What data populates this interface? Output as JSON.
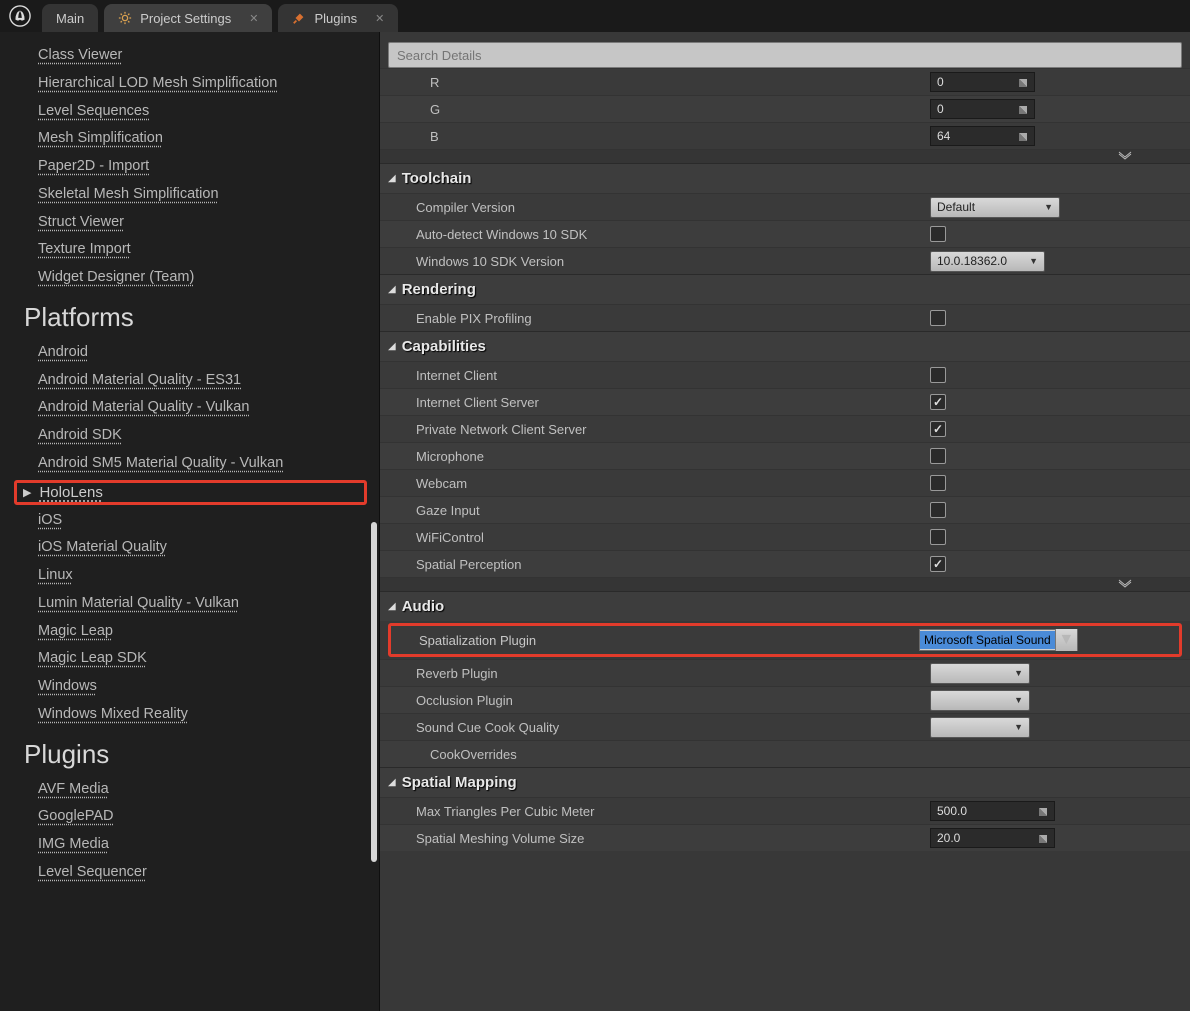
{
  "tabs": {
    "main": "Main",
    "project": "Project Settings",
    "plugins": "Plugins"
  },
  "search": {
    "placeholder": "Search Details"
  },
  "sidebar": {
    "editor_items": [
      "Class Viewer",
      "Hierarchical LOD Mesh Simplification",
      "Level Sequences",
      "Mesh Simplification",
      "Paper2D - Import",
      "Skeletal Mesh Simplification",
      "Struct Viewer",
      "Texture Import",
      "Widget Designer (Team)"
    ],
    "platforms_head": "Platforms",
    "platform_items_a": [
      "Android",
      "Android Material Quality - ES31",
      "Android Material Quality - Vulkan",
      "Android SDK",
      "Android SM5 Material Quality - Vulkan"
    ],
    "hololens": "HoloLens",
    "platform_items_b": [
      "iOS",
      "iOS Material Quality",
      "Linux",
      "Lumin Material Quality - Vulkan",
      "Magic Leap",
      "Magic Leap SDK",
      "Windows",
      "Windows Mixed Reality"
    ],
    "plugins_head": "Plugins",
    "plugin_items": [
      "AVF Media",
      "GooglePAD",
      "IMG Media",
      "Level Sequencer"
    ]
  },
  "rgb": {
    "r_label": "R",
    "r_val": "0",
    "g_label": "G",
    "g_val": "0",
    "b_label": "B",
    "b_val": "64"
  },
  "sections": {
    "toolchain": {
      "title": "Toolchain",
      "compiler_label": "Compiler Version",
      "compiler_val": "Default",
      "autodetect": "Auto-detect Windows 10 SDK",
      "sdk_label": "Windows 10 SDK Version",
      "sdk_val": "10.0.18362.0"
    },
    "rendering": {
      "title": "Rendering",
      "pix": "Enable PIX Profiling"
    },
    "caps": {
      "title": "Capabilities",
      "items": [
        {
          "label": "Internet Client",
          "checked": false
        },
        {
          "label": "Internet Client Server",
          "checked": true
        },
        {
          "label": "Private Network Client Server",
          "checked": true
        },
        {
          "label": "Microphone",
          "checked": false
        },
        {
          "label": "Webcam",
          "checked": false
        },
        {
          "label": "Gaze Input",
          "checked": false
        },
        {
          "label": "WiFiControl",
          "checked": false
        },
        {
          "label": "Spatial Perception",
          "checked": true
        }
      ]
    },
    "audio": {
      "title": "Audio",
      "spatial_label": "Spatialization Plugin",
      "spatial_val": "Microsoft Spatial Sound",
      "reverb": "Reverb Plugin",
      "occlusion": "Occlusion Plugin",
      "cue": "Sound Cue Cook Quality",
      "cook": "CookOverrides"
    },
    "spatial_mapping": {
      "title": "Spatial Mapping",
      "max_tri": "Max Triangles Per Cubic Meter",
      "max_tri_val": "500.0",
      "vol": "Spatial Meshing Volume Size",
      "vol_val": "20.0"
    }
  }
}
